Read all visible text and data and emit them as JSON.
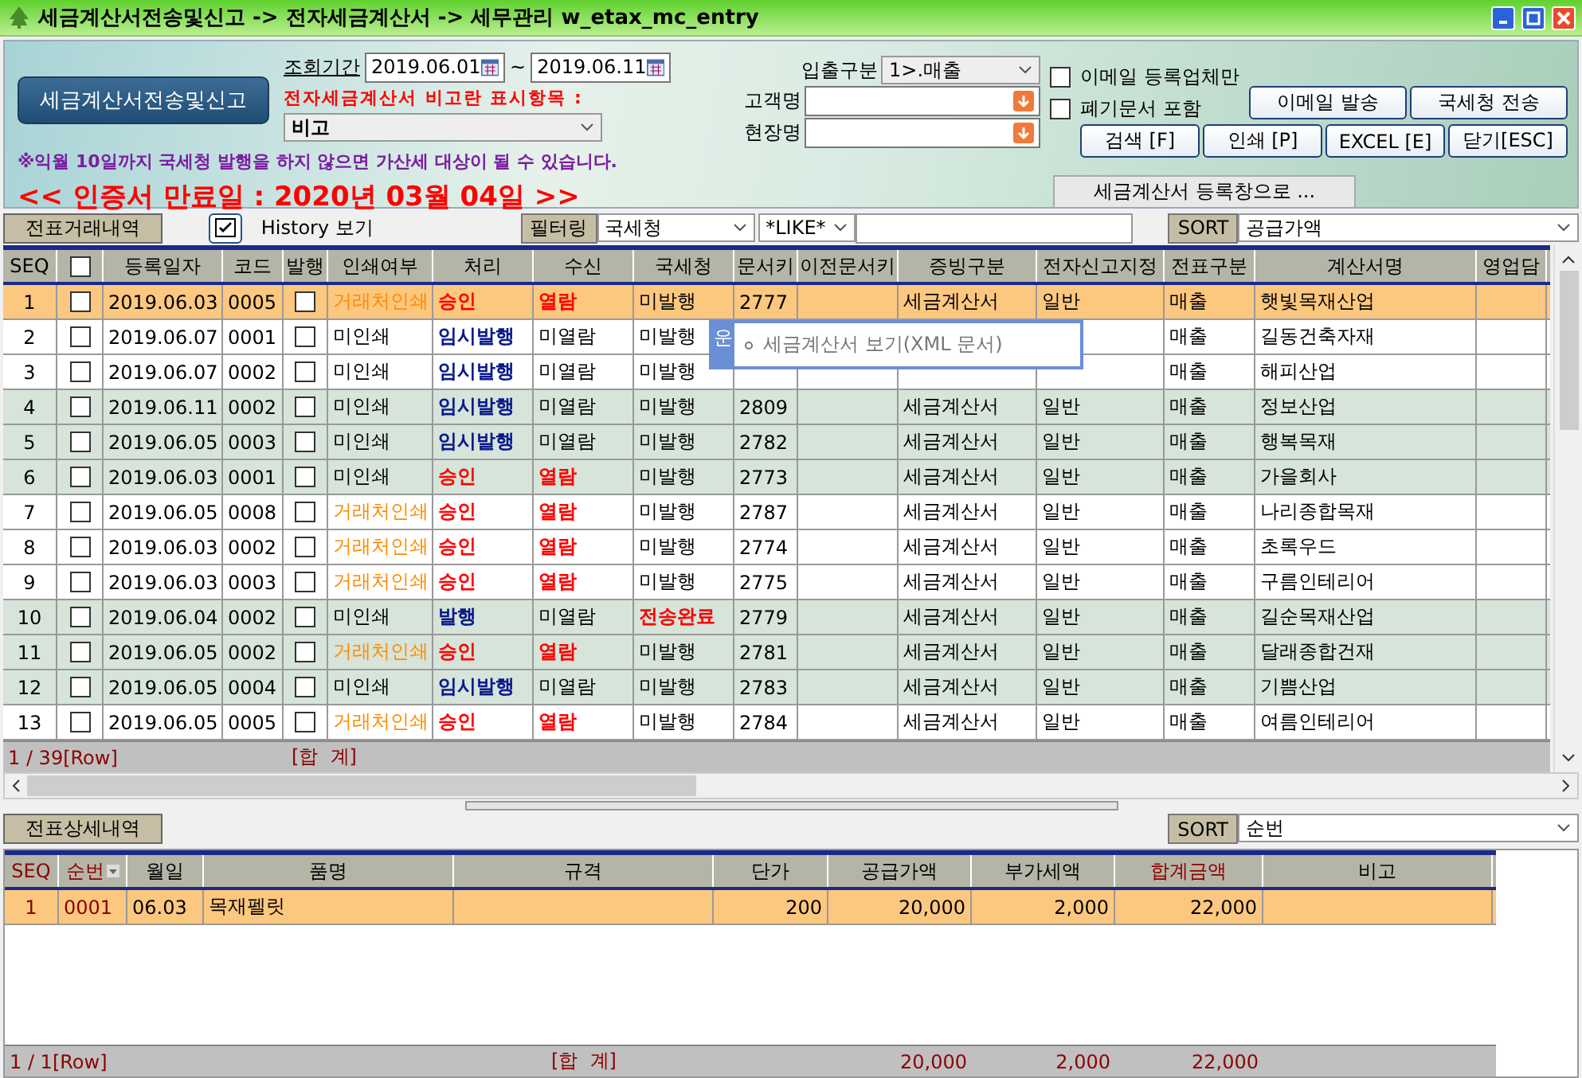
{
  "window": {
    "title": "세금계산서전송및신고 -> 전자세금계산서 -> 세무관리 w_etax_mc_entry"
  },
  "header": {
    "module_button": "세금계산서전송및신고",
    "period_label": "조회기간",
    "date_from": "2019.06.01",
    "date_separator": "~",
    "date_to": "2019.06.11",
    "remark_label": "전자세금계산서 비고란 표시항목 :",
    "remark_select": "비고",
    "notice": "※익월 10일까지 국세청 발행을 하지 않으면 가산세 대상이 될 수 있습니다.",
    "expiry": "<< 인증서 만료일 : 2020년 03월 04일 >>",
    "io_label": "입출구분",
    "io_select": "1>.매출",
    "customer_label": "고객명",
    "site_label": "현장명",
    "options": [
      {
        "label": "이메일 등록업체만",
        "checked": false
      },
      {
        "label": "폐기문서 포함",
        "checked": false
      }
    ],
    "top_buttons": [
      "이메일 발송",
      "국세청 전송"
    ],
    "buttons": [
      "검색 [F]",
      "인쇄 [P]",
      "EXCEL [E]",
      "닫기[ESC]"
    ],
    "register_tab": "세금계산서 등록창으로 ..."
  },
  "toolbar": {
    "section_label": "전표거래내역",
    "history_label": "History 보기",
    "filter_label": "필터링",
    "filter_field": "국세청",
    "match_mode": "*LIKE*",
    "sort_label": "SORT",
    "sort_field": "공급가액"
  },
  "table": {
    "columns": [
      {
        "label": "SEQ"
      },
      {
        "kind": "checkbox",
        "checked": false
      },
      {
        "label": "등록일자"
      },
      {
        "label": "코드"
      },
      {
        "label": "발행"
      },
      {
        "label": "인쇄여부"
      },
      {
        "label": "처리",
        "kind": "status"
      },
      {
        "label": "수신",
        "kind": "status"
      },
      {
        "label": "국세청",
        "kind": "status"
      },
      {
        "label": "문서키"
      },
      {
        "label": "이전문서키"
      },
      {
        "label": "증빙구분"
      },
      {
        "label": "전자신고지정"
      },
      {
        "label": "전표구분"
      },
      {
        "label": "계산서명"
      },
      {
        "label": "영업담"
      }
    ],
    "rows": [
      {
        "selected": true,
        "tinted": false,
        "cells": [
          "1",
          {
            "checked": false
          },
          "2019.06.03",
          "0005",
          {
            "checked": false
          },
          {
            "text": "거래처인쇄",
            "color": "#ff8c00"
          },
          {
            "text": "승인",
            "color": "#ff0000"
          },
          {
            "text": "열람",
            "color": "#ff0000"
          },
          "미발행",
          "2777",
          null,
          "세금계산서",
          "일반",
          "매출",
          "햇빛목재산업",
          null
        ]
      },
      {
        "selected": false,
        "tinted": false,
        "cells": [
          "2",
          {
            "checked": false
          },
          "2019.06.07",
          "0001",
          {
            "checked": false
          },
          "미인쇄",
          {
            "text": "임시발행",
            "color": "#0a1a8c"
          },
          "미열람",
          "미발행",
          null,
          null,
          null,
          null,
          "매출",
          "길동건축자재",
          null
        ]
      },
      {
        "selected": false,
        "tinted": false,
        "cells": [
          "3",
          {
            "checked": false
          },
          "2019.06.07",
          "0002",
          {
            "checked": false
          },
          "미인쇄",
          {
            "text": "임시발행",
            "color": "#0a1a8c"
          },
          "미열람",
          "미발행",
          null,
          null,
          null,
          null,
          "매출",
          "해피산업",
          null
        ]
      },
      {
        "selected": false,
        "tinted": true,
        "cells": [
          "4",
          {
            "checked": false
          },
          "2019.06.11",
          "0002",
          {
            "checked": false
          },
          "미인쇄",
          {
            "text": "임시발행",
            "color": "#0a1a8c"
          },
          "미열람",
          "미발행",
          "2809",
          null,
          "세금계산서",
          "일반",
          "매출",
          "정보산업",
          null
        ]
      },
      {
        "selected": false,
        "tinted": true,
        "cells": [
          "5",
          {
            "checked": false
          },
          "2019.06.05",
          "0003",
          {
            "checked": false
          },
          "미인쇄",
          {
            "text": "임시발행",
            "color": "#0a1a8c"
          },
          "미열람",
          "미발행",
          "2782",
          null,
          "세금계산서",
          "일반",
          "매출",
          "행복목재",
          null
        ]
      },
      {
        "selected": false,
        "tinted": true,
        "cells": [
          "6",
          {
            "checked": false
          },
          "2019.06.03",
          "0001",
          {
            "checked": false
          },
          "미인쇄",
          {
            "text": "승인",
            "color": "#ff0000"
          },
          {
            "text": "열람",
            "color": "#ff0000"
          },
          "미발행",
          "2773",
          null,
          "세금계산서",
          "일반",
          "매출",
          "가을회사",
          null
        ]
      },
      {
        "selected": false,
        "tinted": false,
        "cells": [
          "7",
          {
            "checked": false
          },
          "2019.06.05",
          "0008",
          {
            "checked": false
          },
          {
            "text": "거래처인쇄",
            "color": "#ff8c00"
          },
          {
            "text": "승인",
            "color": "#ff0000"
          },
          {
            "text": "열람",
            "color": "#ff0000"
          },
          "미발행",
          "2787",
          null,
          "세금계산서",
          "일반",
          "매출",
          "나리종합목재",
          null
        ]
      },
      {
        "selected": false,
        "tinted": false,
        "cells": [
          "8",
          {
            "checked": false
          },
          "2019.06.03",
          "0002",
          {
            "checked": false
          },
          {
            "text": "거래처인쇄",
            "color": "#ff8c00"
          },
          {
            "text": "승인",
            "color": "#ff0000"
          },
          {
            "text": "열람",
            "color": "#ff0000"
          },
          "미발행",
          "2774",
          null,
          "세금계산서",
          "일반",
          "매출",
          "초록우드",
          null
        ]
      },
      {
        "selected": false,
        "tinted": false,
        "cells": [
          "9",
          {
            "checked": false
          },
          "2019.06.03",
          "0003",
          {
            "checked": false
          },
          {
            "text": "거래처인쇄",
            "color": "#ff8c00"
          },
          {
            "text": "승인",
            "color": "#ff0000"
          },
          {
            "text": "열람",
            "color": "#ff0000"
          },
          "미발행",
          "2775",
          null,
          "세금계산서",
          "일반",
          "매출",
          "구름인테리어",
          null
        ]
      },
      {
        "selected": false,
        "tinted": true,
        "cells": [
          "10",
          {
            "checked": false
          },
          "2019.06.04",
          "0002",
          {
            "checked": false
          },
          "미인쇄",
          {
            "text": "발행",
            "color": "#0a1a8c"
          },
          "미열람",
          {
            "text": "전송완료",
            "color": "#ff0000"
          },
          "2779",
          null,
          "세금계산서",
          "일반",
          "매출",
          "길순목재산업",
          null
        ]
      },
      {
        "selected": false,
        "tinted": true,
        "cells": [
          "11",
          {
            "checked": false
          },
          "2019.06.05",
          "0002",
          {
            "checked": false
          },
          {
            "text": "거래처인쇄",
            "color": "#ff8c00"
          },
          {
            "text": "승인",
            "color": "#ff0000"
          },
          {
            "text": "열람",
            "color": "#ff0000"
          },
          "미발행",
          "2781",
          null,
          "세금계산서",
          "일반",
          "매출",
          "달래종합건재",
          null
        ]
      },
      {
        "selected": false,
        "tinted": true,
        "cells": [
          "12",
          {
            "checked": false
          },
          "2019.06.05",
          "0004",
          {
            "checked": false
          },
          "미인쇄",
          {
            "text": "임시발행",
            "color": "#0a1a8c"
          },
          "미열람",
          "미발행",
          "2783",
          null,
          "세금계산서",
          "일반",
          "매출",
          "기쁨산업",
          null
        ]
      },
      {
        "selected": false,
        "tinted": false,
        "cells": [
          "13",
          {
            "checked": false
          },
          "2019.06.05",
          "0005",
          {
            "checked": false
          },
          {
            "text": "거래처인쇄",
            "color": "#ff8c00"
          },
          {
            "text": "승인",
            "color": "#ff0000"
          },
          {
            "text": "열람",
            "color": "#ff0000"
          },
          "미발행",
          "2784",
          null,
          "세금계산서",
          "일반",
          "매출",
          "여름인테리어",
          null
        ]
      }
    ],
    "footer": {
      "row_count": "1 / 39[Row]",
      "total_label": "[합  계]"
    }
  },
  "context_menu": {
    "tab": "운",
    "item": "세금계산서 보기(XML 문서)"
  },
  "detail": {
    "section_label": "전표상세내역",
    "sort_label": "SORT",
    "sort_field": "순번",
    "columns": [
      {
        "label": "SEQ",
        "accent": true
      },
      {
        "label": "순번",
        "accent": true,
        "sorted": true
      },
      {
        "label": "월일"
      },
      {
        "label": "품명"
      },
      {
        "label": "규격"
      },
      {
        "label": "단가",
        "numeric": true
      },
      {
        "label": "공급가액",
        "numeric": true
      },
      {
        "label": "부가세액",
        "numeric": true
      },
      {
        "label": "합계금액",
        "accent": true,
        "numeric": true
      },
      {
        "label": "비고"
      }
    ],
    "rows": [
      {
        "selected": true,
        "cells": [
          {
            "text": "1",
            "color": "#8b0000"
          },
          {
            "text": "0001",
            "color": "#8b0000"
          },
          "06.03",
          "목재펠릿",
          null,
          "200",
          "20,000",
          "2,000",
          "22,000",
          null
        ]
      }
    ],
    "footer": {
      "row_count": "1 / 1[Row]",
      "total_label": "[합  계]",
      "totals": [
        "20,000",
        "2,000",
        "22,000"
      ]
    }
  }
}
